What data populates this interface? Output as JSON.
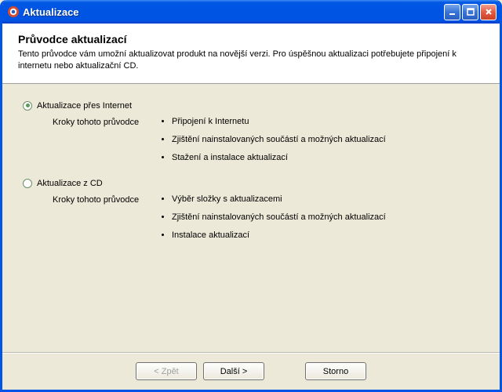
{
  "window": {
    "title": "Aktualizace"
  },
  "header": {
    "heading": "Průvodce aktualizací",
    "description": "Tento průvodce vám umožní aktualizovat produkt na novější verzi. Pro úspěšnou aktualizaci potřebujete připojení k internetu nebo aktualizační CD."
  },
  "options": {
    "internet": {
      "label": "Aktualizace přes Internet",
      "steps_label": "Kroky tohoto průvodce",
      "step1": "Připojení k Internetu",
      "step2": "Zjištění nainstalovaných součástí a možných aktualizací",
      "step3": "Stažení a instalace aktualizací"
    },
    "cd": {
      "label": "Aktualizace z CD",
      "steps_label": "Kroky tohoto průvodce",
      "step1": "Výběr složky s aktualizacemi",
      "step2": "Zjištění nainstalovaných součástí a možných aktualizací",
      "step3": "Instalace aktualizací"
    }
  },
  "buttons": {
    "back": "< Zpět",
    "next": "Další >",
    "cancel": "Storno"
  }
}
